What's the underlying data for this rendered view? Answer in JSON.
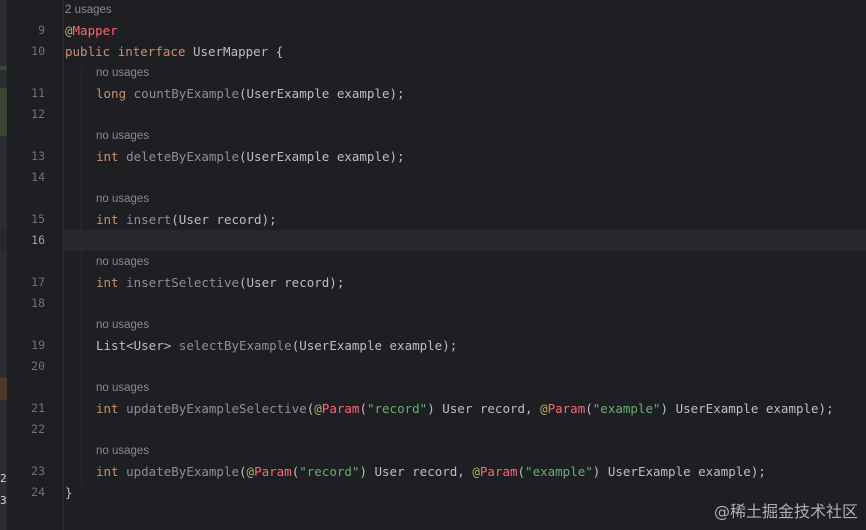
{
  "editor": {
    "top_hint": "2 usages",
    "method_hint": "no usages",
    "gutter": {
      "l9": "9",
      "l10": "10",
      "l11": "11",
      "l12": "12",
      "l13": "13",
      "l14": "14",
      "l15": "15",
      "l16": "16",
      "l17": "17",
      "l18": "18",
      "l19": "19",
      "l20": "20",
      "l21": "21",
      "l22": "22",
      "l23": "23",
      "l24": "24"
    },
    "edge_digits": [
      "2",
      "3"
    ],
    "tokens": {
      "at": "@",
      "mapper": "Mapper",
      "public": "public",
      "interface": "interface",
      "class_decl": " UserMapper {",
      "long": "long",
      "int": "int",
      "countByExample": "countByExample",
      "deleteByExample": "deleteByExample",
      "insert": "insert",
      "insertSelective": "insertSelective",
      "selectByExample": "selectByExample",
      "updateByExampleSelective": "updateByExampleSelective",
      "updateByExample": "updateByExample",
      "param": "Param",
      "open_paren": "(",
      "close_paren": ")",
      "example_params": "(UserExample example);",
      "record_params": "(User record);",
      "list_type": "List<User> ",
      "rec_str": "\"record\"",
      "ex_str": "\"example\"",
      "user_record_comma": " User record, ",
      "userexample_example_end": " UserExample example);",
      "close_brace": "}"
    }
  },
  "watermark": "@稀土掘金技术社区",
  "colors": {
    "background": "#1e1f22",
    "keyword": "#cf8e6d",
    "annotation": "#fa6675",
    "string": "#6aab73",
    "unused_method": "#8c8f94",
    "hint": "#868a91"
  }
}
